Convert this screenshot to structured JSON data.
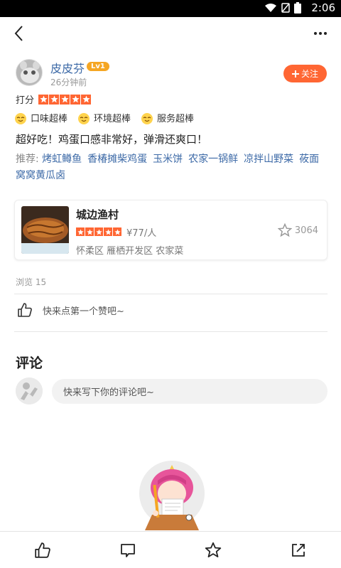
{
  "status_bar": {
    "time": "2:06"
  },
  "post": {
    "username": "皮皮芬",
    "level": "Lv1",
    "time_ago": "26分钟前",
    "follow_label": "关注",
    "rating_label": "打分",
    "rating_stars": 5,
    "tags": [
      "口味超棒",
      "环境超棒",
      "服务超棒"
    ],
    "text": "超好吃！鸡蛋口感非常好，弹滑还爽口！",
    "recommend_label": "推荐:",
    "recommend_dishes": [
      "烤虹鳟鱼",
      "香椿摊柴鸡蛋",
      "玉米饼",
      "农家一锅鲜",
      "凉拌山野菜",
      "莜面窝窝黄瓜卤"
    ]
  },
  "shop": {
    "name": "城边渔村",
    "stars": 5,
    "price": "¥77/人",
    "meta": "怀柔区 雁栖开发区 农家菜",
    "favorites": "3064"
  },
  "stats": {
    "browse": "浏览 15",
    "like_prompt": "快来点第一个赞吧~"
  },
  "comments": {
    "title": "评论",
    "placeholder": "快来写下你的评论吧~"
  },
  "colors": {
    "accent": "#ff6633",
    "link": "#3d6aa7",
    "badge": "#f5a623"
  },
  "icons": {
    "back": "back-arrow-icon",
    "more": "more-dots-icon",
    "like": "thumbs-up-icon",
    "comment": "comment-icon",
    "favorite": "star-icon",
    "share": "share-icon"
  }
}
